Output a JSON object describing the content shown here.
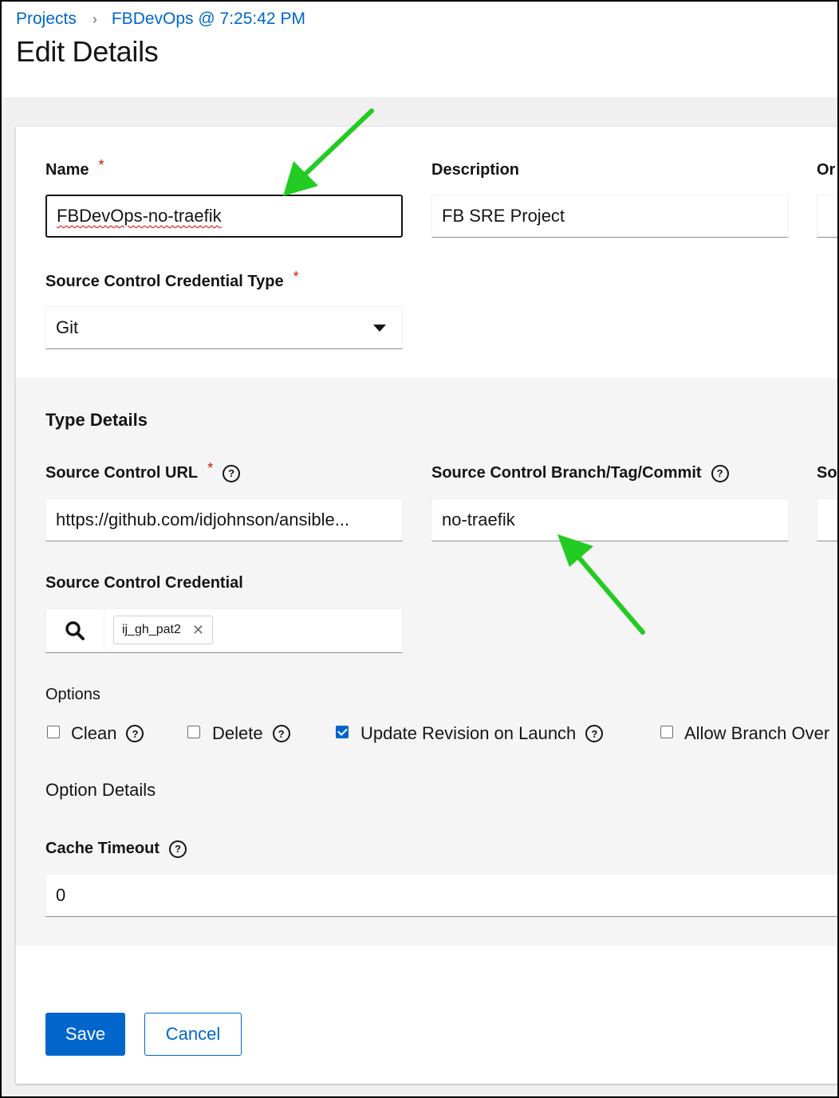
{
  "breadcrumb": {
    "projects": "Projects",
    "separator": "›",
    "current": "FBDevOps @ 7:25:42 PM"
  },
  "page_title": "Edit Details",
  "form": {
    "name": {
      "label": "Name",
      "required": "*",
      "value": "FBDevOps-no-traefik"
    },
    "description": {
      "label": "Description",
      "value": "FB SRE Project"
    },
    "organization": {
      "label_partial": "Or"
    },
    "scm_type": {
      "label": "Source Control Credential Type",
      "required": "*",
      "value": "Git"
    },
    "type_details": {
      "title": "Type Details",
      "url": {
        "label": "Source Control URL",
        "required": "*",
        "value": "https://github.com/idjohnson/ansible..."
      },
      "branch": {
        "label": "Source Control Branch/Tag/Commit",
        "value": "no-traefik"
      },
      "refspec_partial": "So",
      "credential": {
        "label": "Source Control Credential",
        "chip": "ij_gh_pat2",
        "chip_remove": "✕"
      }
    },
    "options": {
      "title": "Options",
      "items": [
        {
          "label": "Clean",
          "checked": false
        },
        {
          "label": "Delete",
          "checked": false
        },
        {
          "label": "Update Revision on Launch",
          "checked": true
        },
        {
          "label": "Allow Branch Over",
          "checked": false
        }
      ]
    },
    "option_details": {
      "title": "Option Details",
      "cache_timeout": {
        "label": "Cache Timeout",
        "value": "0"
      }
    }
  },
  "help_glyph": "?",
  "actions": {
    "save": "Save",
    "cancel": "Cancel"
  },
  "colors": {
    "accent": "#0066cc",
    "required": "#c9190b",
    "annotation_arrow": "#22cc22"
  },
  "icons": [
    "chevron-right-icon",
    "caret-down-icon",
    "help-icon",
    "search-icon",
    "close-icon",
    "check-icon"
  ]
}
